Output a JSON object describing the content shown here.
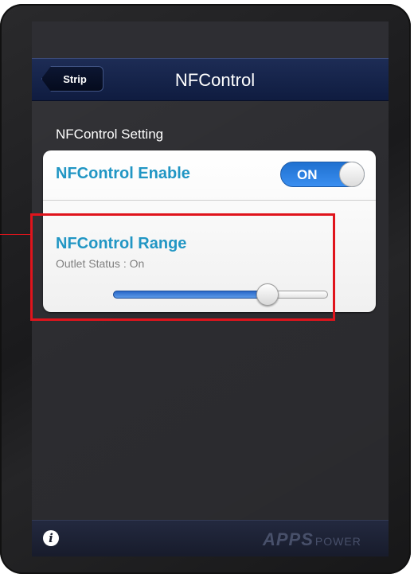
{
  "navbar": {
    "back_label": "Strip",
    "title": "NFControl"
  },
  "section": {
    "header": "NFControl Setting"
  },
  "enable_row": {
    "label": "NFControl Enable",
    "toggle_state": "ON"
  },
  "range_row": {
    "label": "NFControl Range",
    "status": "Outlet Status : On",
    "slider_value_fraction": 0.72
  },
  "bottom_bar": {
    "info_icon": "info-icon",
    "brand_main": "APPS",
    "brand_sub": "POWER"
  },
  "colors": {
    "accent_label": "#2196c4",
    "navbar": "#15224a",
    "toggle_on": "#2a7fe0",
    "highlight": "#e0141c"
  }
}
